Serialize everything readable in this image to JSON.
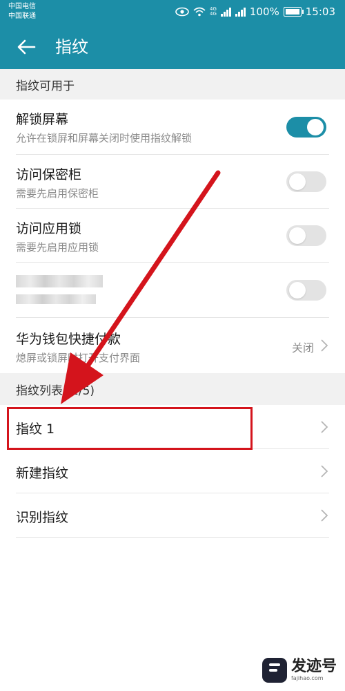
{
  "status_bar": {
    "carrier_1": "中国电信",
    "carrier_2": "中国联通",
    "battery_text": "100%",
    "time": "15:03",
    "net_tag_1": "4G",
    "net_tag_2": "4G"
  },
  "app_bar": {
    "title": "指纹"
  },
  "section_usage": {
    "header": "指纹可用于",
    "items": [
      {
        "title": "解锁屏幕",
        "subtitle": "允许在锁屏和屏幕关闭时使用指纹解锁",
        "toggle": "on"
      },
      {
        "title": "访问保密柜",
        "subtitle": "需要先启用保密柜",
        "toggle": "off"
      },
      {
        "title": "访问应用锁",
        "subtitle": "需要先启用应用锁",
        "toggle": "off"
      },
      {
        "title": "",
        "subtitle": "",
        "toggle": "off"
      },
      {
        "title": "华为钱包快捷付款",
        "subtitle": "熄屏或锁屏时打开支付界面",
        "value": "关闭"
      }
    ]
  },
  "section_list": {
    "header": "指纹列表 (1/5)",
    "items": [
      {
        "title": "指纹 1"
      },
      {
        "title": "新建指纹"
      },
      {
        "title": "识别指纹"
      }
    ]
  },
  "watermark": {
    "name": "发迹号",
    "url": "fajihao.com"
  },
  "colors": {
    "accent": "#1c8ea7",
    "annotation_red": "#d4141c"
  }
}
